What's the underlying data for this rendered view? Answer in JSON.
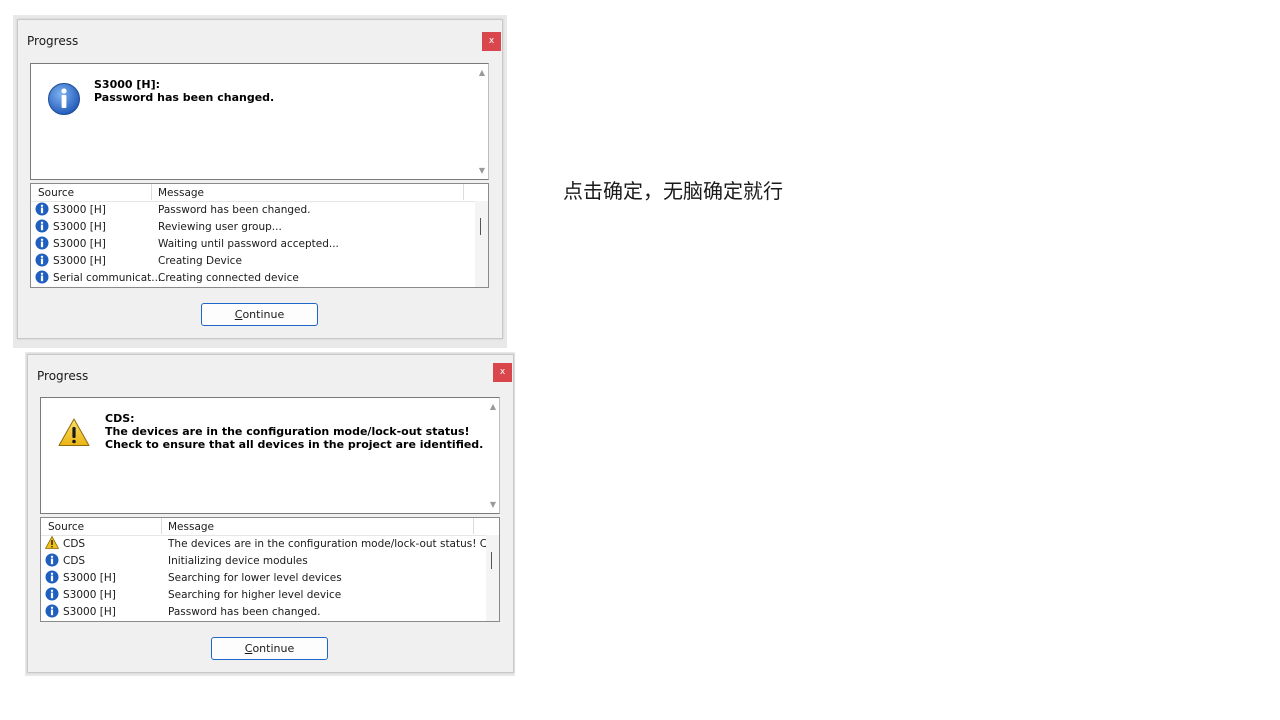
{
  "annotation_note": "点击确定，无脑确定就行",
  "dialog1": {
    "title": "Progress",
    "close_label": "x",
    "message_line1": "S3000 [H]:",
    "message_line2": "Password has been changed.",
    "col_source": "Source",
    "col_message": "Message",
    "rows": [
      {
        "icon": "info",
        "source": "S3000 [H]",
        "message": "Password has been changed."
      },
      {
        "icon": "info",
        "source": "S3000 [H]",
        "message": "Reviewing user group..."
      },
      {
        "icon": "info",
        "source": "S3000 [H]",
        "message": "Waiting until password accepted..."
      },
      {
        "icon": "info",
        "source": "S3000 [H]",
        "message": "Creating Device"
      },
      {
        "icon": "info",
        "source": "Serial communicat...",
        "message": "Creating connected device"
      }
    ],
    "button_underlined": "C",
    "button_rest": "ontinue"
  },
  "dialog2": {
    "title": "Progress",
    "close_label": "x",
    "message_line1": "CDS:",
    "message_line2": "The devices are in the configuration mode/lock-out status!",
    "message_line3": "Check to ensure that all devices in the project are identified.",
    "col_source": "Source",
    "col_message": "Message",
    "rows": [
      {
        "icon": "warning",
        "source": "CDS",
        "message": "The devices are in the configuration mode/lock-out status! C..."
      },
      {
        "icon": "info",
        "source": "CDS",
        "message": "Initializing device modules"
      },
      {
        "icon": "info",
        "source": "S3000 [H]",
        "message": "Searching for lower level devices"
      },
      {
        "icon": "info",
        "source": "S3000 [H]",
        "message": "Searching for higher level device"
      },
      {
        "icon": "info",
        "source": "S3000 [H]",
        "message": "Password has been changed."
      }
    ],
    "button_underlined": "C",
    "button_rest": "ontinue"
  },
  "colors": {
    "accent": "#1e66c8",
    "close": "#d9474c",
    "info": "#1f5fbf",
    "warning": "#f2c21b"
  }
}
